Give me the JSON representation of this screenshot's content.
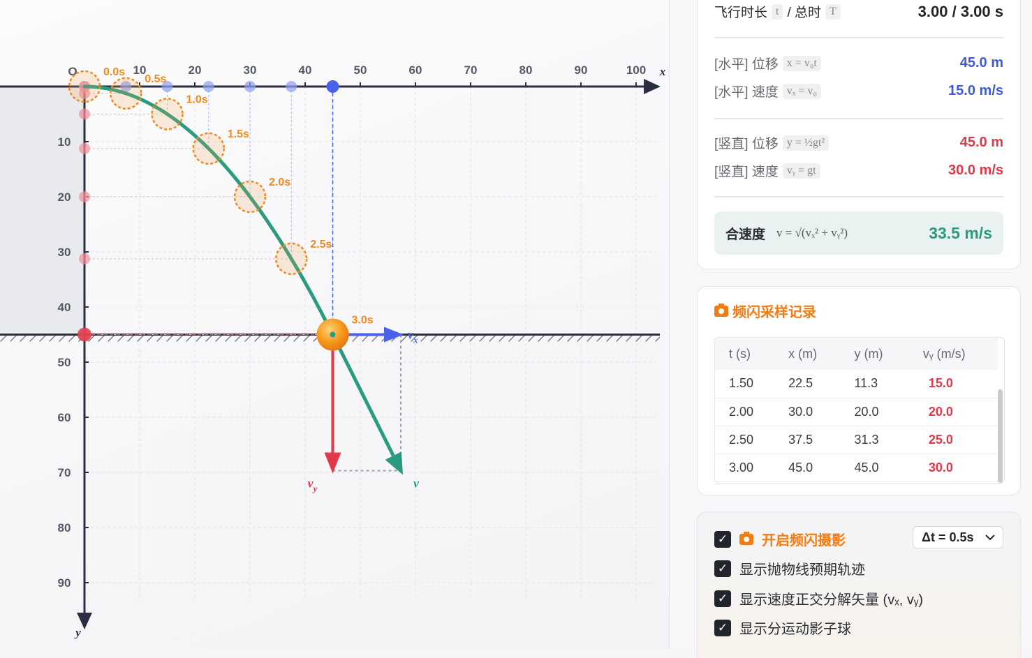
{
  "plot": {
    "origin_label": "O",
    "x_axis_label": "x",
    "y_axis_label": "y",
    "x_ticks": [
      "10",
      "20",
      "30",
      "40",
      "50",
      "60",
      "70",
      "80",
      "90",
      "100"
    ],
    "y_ticks": [
      "10",
      "20",
      "30",
      "40",
      "50",
      "60",
      "70",
      "80",
      "90"
    ],
    "flash_labels": [
      "0.0s",
      "0.5s",
      "1.0s",
      "1.5s",
      "2.0s",
      "2.5s",
      "3.0s"
    ],
    "vector_labels": {
      "vx": "v",
      "vx_sub": "x",
      "vy": "v",
      "vy_sub": "y",
      "v": "v"
    },
    "colors": {
      "trajectory": "#2a9a80",
      "vx": "#4a62e8",
      "vy": "#e1384a",
      "flash": "#f08a1c",
      "axis": "#2b2d40"
    }
  },
  "chart_data": {
    "type": "scatter",
    "description_units": "x (m), y (m, downward)",
    "flash_points": [
      {
        "t": 0.0,
        "x": 0.0,
        "y": 0.0
      },
      {
        "t": 0.5,
        "x": 7.5,
        "y": 1.25
      },
      {
        "t": 1.0,
        "x": 15.0,
        "y": 5.0
      },
      {
        "t": 1.5,
        "x": 22.5,
        "y": 11.25
      },
      {
        "t": 2.0,
        "x": 30.0,
        "y": 20.0
      },
      {
        "t": 2.5,
        "x": 37.5,
        "y": 31.25
      },
      {
        "t": 3.0,
        "x": 45.0,
        "y": 45.0
      }
    ],
    "ball": {
      "x": 45.0,
      "y": 45.0
    },
    "ground_y": 45,
    "vx": 15.0,
    "vy": 30.0,
    "xlim": [
      0,
      100
    ],
    "ylim": [
      0,
      90
    ]
  },
  "panel": {
    "flight_time_label": "飞行时长",
    "t_chip": "t",
    "total_label": "/ 总时",
    "T_chip": "T",
    "flight_time_value": "3.00 / 3.00 s",
    "hx_label": "[水平] 位移",
    "hx_formula": "x = v₀t",
    "hx_value": "45.0 m",
    "hv_label": "[水平] 速度",
    "hv_formula": "vₓ = v₀",
    "hv_value": "15.0 m/s",
    "vy_disp_label": "[竖直] 位移",
    "vy_disp_formula": "y = ½gt²",
    "vy_disp_value": "45.0 m",
    "vv_label": "[竖直] 速度",
    "vv_formula": "vᵧ = gt",
    "vv_value": "30.0 m/s",
    "speed_label": "合速度",
    "speed_formula": "v = √(vₓ² + vᵧ²)",
    "speed_value": "33.5 m/s"
  },
  "records": {
    "title": "频闪采样记录",
    "headers": [
      "t (s)",
      "x (m)",
      "y (m)",
      "vᵧ (m/s)"
    ],
    "rows": [
      [
        "1.50",
        "22.5",
        "11.3",
        "15.0"
      ],
      [
        "2.00",
        "30.0",
        "20.0",
        "20.0"
      ],
      [
        "2.50",
        "37.5",
        "31.3",
        "25.0"
      ],
      [
        "3.00",
        "45.0",
        "45.0",
        "30.0"
      ]
    ]
  },
  "controls": {
    "flash_label": "开启频闪摄影",
    "flash_checked": true,
    "dt_value": "Δt = 0.5s",
    "opt1": "显示抛物线预期轨迹",
    "opt2": "显示速度正交分解矢量 (vₓ, vᵧ)",
    "opt3": "显示分运动影子球"
  }
}
